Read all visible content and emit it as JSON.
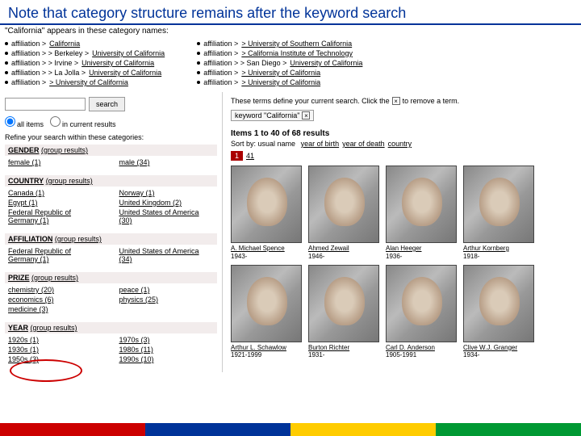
{
  "title": "Note that category structure remains after the keyword search",
  "cat_intro": "\"California\" appears in these category names:",
  "cat_left": [
    {
      "prefix": "affiliation >",
      "link": "California"
    },
    {
      "prefix": "affiliation >",
      "mid": "> Berkeley >",
      "link": "University of California"
    },
    {
      "prefix": "affiliation >",
      "mid": "> Irvine >",
      "link": "University of California"
    },
    {
      "prefix": "affiliation >",
      "mid": "> La Jolla >",
      "link": "University of California"
    },
    {
      "prefix": "affiliation >",
      "link2": "> University of California"
    }
  ],
  "cat_right": [
    {
      "prefix": "affiliation >",
      "link": "> University of Southern California"
    },
    {
      "prefix": "affiliation >",
      "link": "> California Institute of Technology"
    },
    {
      "prefix": "affiliation >",
      "mid": "> San Diego >",
      "link": "University of California"
    },
    {
      "prefix": "affiliation >",
      "link": "> University of California"
    },
    {
      "prefix": "affiliation >",
      "link": "> University of California"
    }
  ],
  "search": {
    "button": "search",
    "radio_all": "all items",
    "radio_current": "in current results"
  },
  "refine_text": "Refine your search within these categories:",
  "facets": {
    "gender": {
      "label": "GENDER",
      "grp": "(group results)",
      "colA": [
        "female (1)"
      ],
      "colB": [
        "male (34)"
      ]
    },
    "country": {
      "label": "COUNTRY",
      "grp": "(group results)",
      "colA": [
        "Canada (1)",
        "Egypt (1)",
        "Federal Republic of Germany (1)"
      ],
      "colB": [
        "Norway (1)",
        "United Kingdom (2)",
        "United States of America (30)"
      ]
    },
    "affiliation": {
      "label": "AFFILIATION",
      "grp": "(group results)",
      "colA": [
        "Federal Republic of Germany (1)"
      ],
      "colB": [
        "United States of America (34)"
      ]
    },
    "prize": {
      "label": "PRIZE",
      "grp": "(group results)",
      "colA": [
        "chemistry (20)",
        "economics (6)",
        "medicine (3)"
      ],
      "colB": [
        "peace (1)",
        "physics (25)"
      ]
    },
    "year": {
      "label": "YEAR",
      "grp": "(group results)",
      "colA": [
        "1920s (1)",
        "1930s (1)",
        "1950s (3)"
      ],
      "colB": [
        "1970s (3)",
        "1980s (11)",
        "1990s (10)"
      ]
    }
  },
  "terms_line": "These terms define your current search. Click the",
  "terms_line2": "to remove a term.",
  "chip": "keyword \"California\"",
  "items_count": "Items 1 to 40 of 68 results",
  "sort_prefix": "Sort by:",
  "sort_current": "usual name",
  "sorts": [
    "year of birth",
    "year of death",
    "country"
  ],
  "pager": {
    "p1": "1",
    "p2": "41"
  },
  "people": [
    {
      "name": "A. Michael Spence",
      "years": "1943-"
    },
    {
      "name": "Ahmed Zewail",
      "years": "1946-"
    },
    {
      "name": "Alan Heeger",
      "years": "1936-"
    },
    {
      "name": "Arthur Kornberg",
      "years": "1918-"
    },
    {
      "name": "Arthur L. Schawlow",
      "years": "1921-1999"
    },
    {
      "name": "Burton Richter",
      "years": "1931-"
    },
    {
      "name": "Carl D. Anderson",
      "years": "1905-1991"
    },
    {
      "name": "Clive W.J. Granger",
      "years": "1934-"
    }
  ]
}
